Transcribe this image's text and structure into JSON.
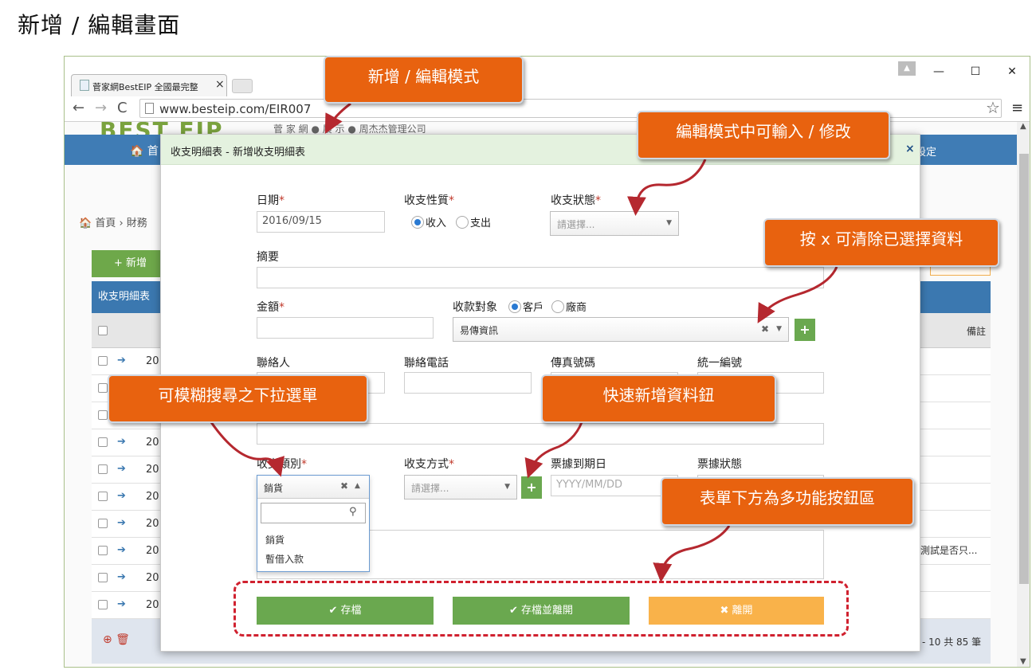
{
  "page_heading": "新增 / 編輯畫面",
  "browser": {
    "tab_label": "菅家網BestEIP 全國最完整",
    "tab_close": "×",
    "url": "www.besteip.com/EIR007",
    "window_controls": {
      "minimize": "—",
      "maximize": "☐",
      "close": "✕"
    }
  },
  "background_page": {
    "logo": "BEST EIP",
    "subtitle": "菅 家 網 ● 展 示 ● 周杰杰管理公司",
    "nav_home": "🏠 首",
    "nav_right": "設定",
    "breadcrumb": "🏠 首頁 › 財務",
    "add_button": "+ 新增",
    "table_title": "收支明細表",
    "remark_header": "備註",
    "row_year": "20",
    "remark_cell": "測試是否只...",
    "pager_text": "- 10 共 85 筆"
  },
  "modal": {
    "title": "收支明細表 - 新增收支明細表",
    "close": "×",
    "labels": {
      "date": "日期",
      "nature": "收支性質",
      "status": "收支狀態",
      "summary": "摘要",
      "amount": "金額",
      "target": "收款對象",
      "contact": "聯絡人",
      "phone": "聯絡電話",
      "fax": "傳真號碼",
      "tax_id": "統一編號",
      "category": "收支類別",
      "method": "收支方式",
      "due_date": "票據到期日",
      "bill_status": "票據狀態"
    },
    "required_mark": "*",
    "date_value": "2016/09/15",
    "nature_options": [
      "收入",
      "支出"
    ],
    "status_placeholder": "請選擇...",
    "target_options": [
      "客戶",
      "廠商"
    ],
    "target_value": "易傳資訊",
    "category_value": "銷貨",
    "category_options": [
      "銷貨",
      "暫借入款"
    ],
    "method_placeholder": "請選擇...",
    "due_date_placeholder": "YYYY/MM/DD",
    "buttons": {
      "save": "存檔",
      "save_close": "存檔並離開",
      "leave": "離開"
    }
  },
  "callouts": {
    "mode": "新增 / 編輯模式",
    "editable": "編輯模式中可輸入 / 修改",
    "clear": "按 x 可清除已選擇資料",
    "fuzzy": "可模糊搜尋之下拉選單",
    "quick_add": "快速新增資料鈕",
    "toolbar": "表單下方為多功能按鈕區"
  },
  "colors": {
    "callout": "#e8620f",
    "save_button": "#6aa84f",
    "leave_button": "#f9b24a",
    "modal_header": "#e4f2df",
    "nav": "#3f7cb5",
    "highlight_border": "#d0212f"
  }
}
